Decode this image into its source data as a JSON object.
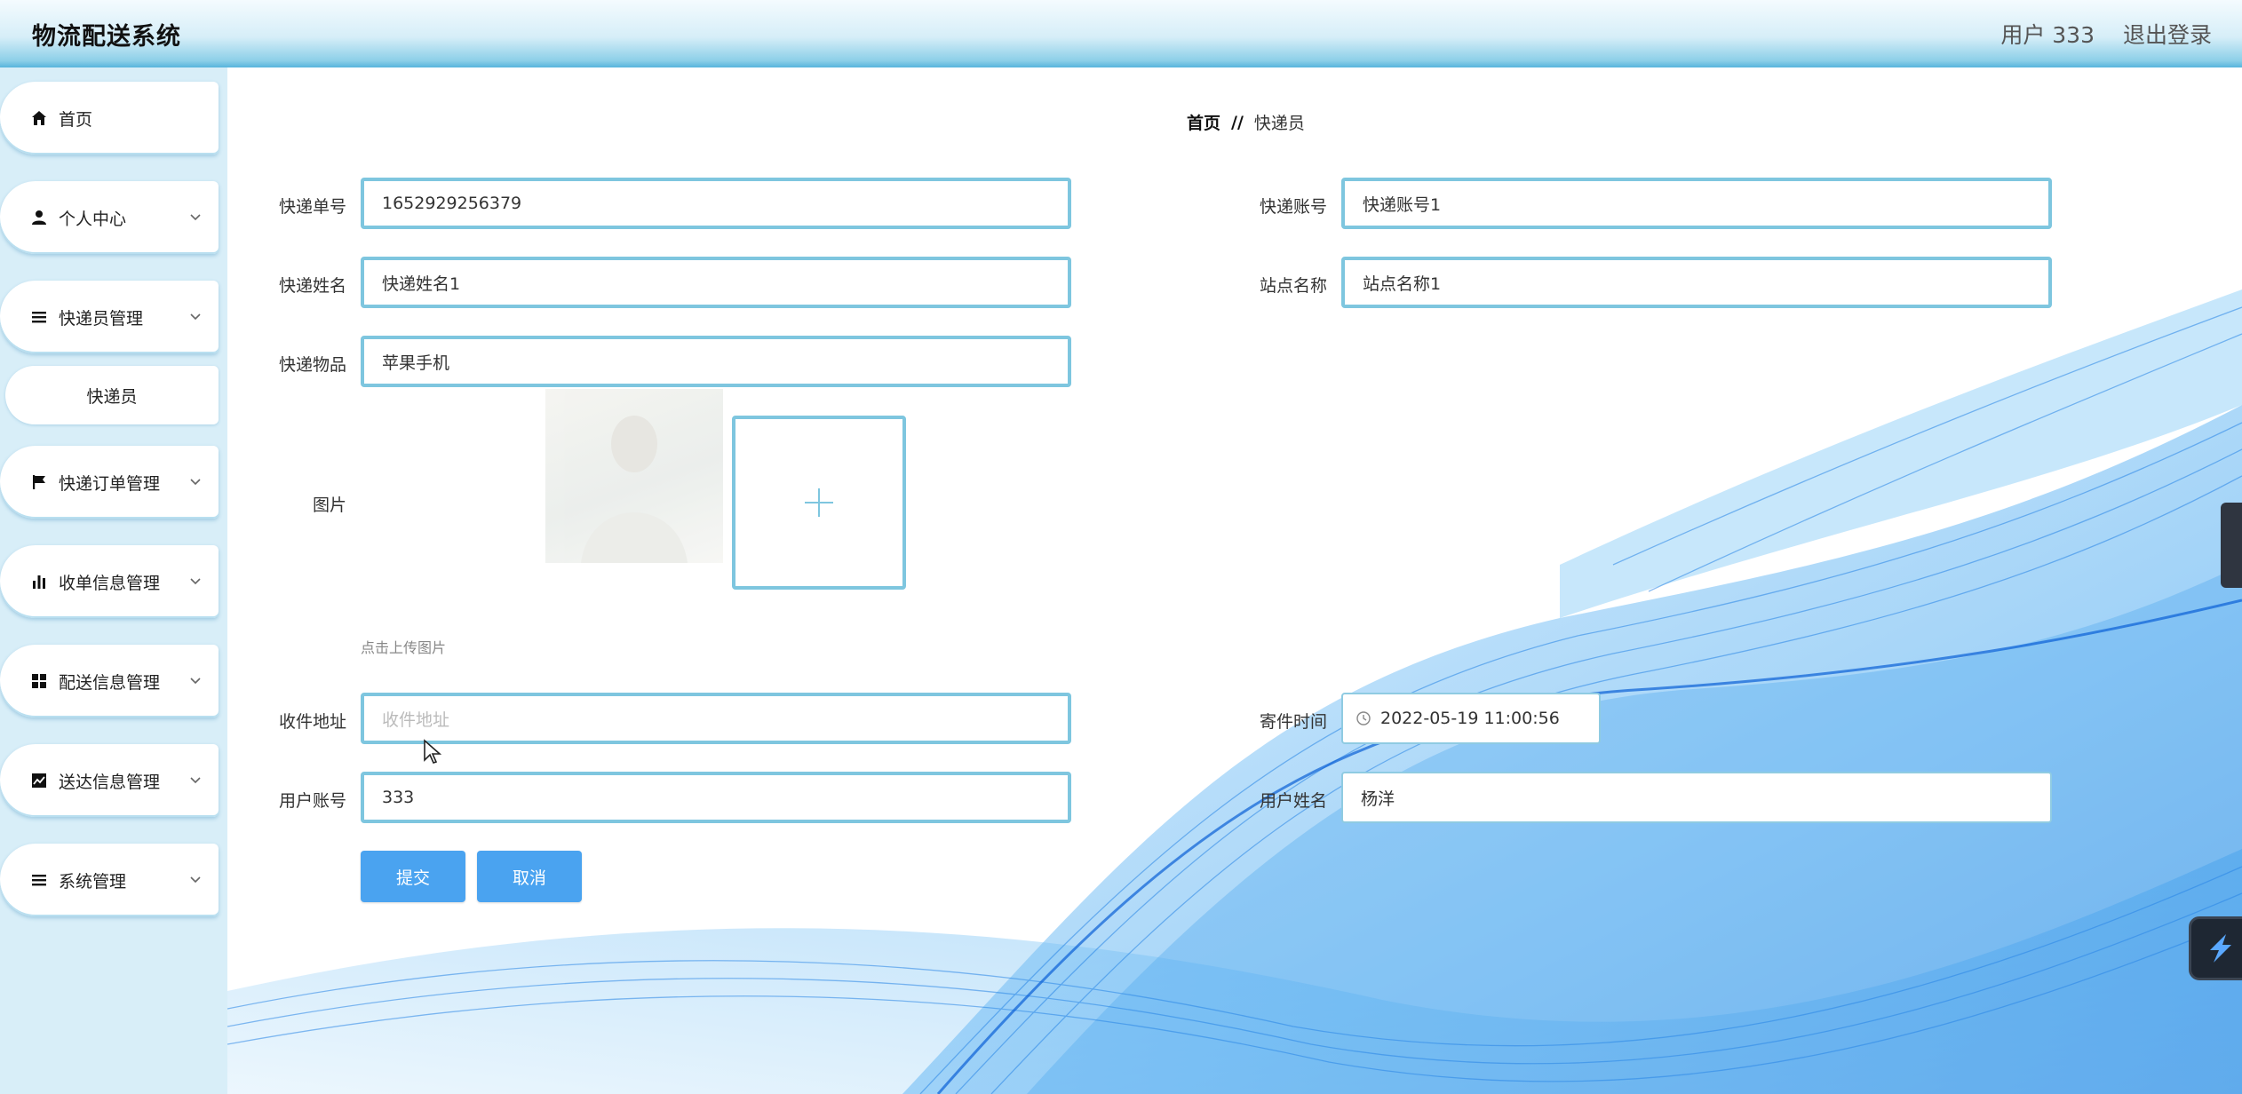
{
  "header": {
    "title": "物流配送系统",
    "user": "用户 333",
    "logout": "退出登录"
  },
  "sidebar": {
    "items": [
      {
        "label": "首页",
        "icon": "home-icon"
      },
      {
        "label": "个人中心",
        "icon": "user-icon"
      },
      {
        "label": "快递员管理",
        "icon": "list-icon"
      },
      {
        "label": "快递员",
        "icon": ""
      },
      {
        "label": "快递订单管理",
        "icon": "flag-icon"
      },
      {
        "label": "收单信息管理",
        "icon": "bar-chart-icon"
      },
      {
        "label": "配送信息管理",
        "icon": "grid-icon"
      },
      {
        "label": "送达信息管理",
        "icon": "line-chart-icon"
      },
      {
        "label": "系统管理",
        "icon": "list-icon"
      }
    ]
  },
  "breadcrumb": {
    "home": "首页",
    "sep": "//",
    "current": "快递员"
  },
  "form": {
    "tracking_no": {
      "label": "快递单号",
      "value": "1652929256379"
    },
    "courier_account": {
      "label": "快递账号",
      "value": "快递账号1"
    },
    "courier_name": {
      "label": "快递姓名",
      "value": "快递姓名1"
    },
    "station_name": {
      "label": "站点名称",
      "value": "站点名称1"
    },
    "item": {
      "label": "快递物品",
      "value": "苹果手机"
    },
    "image": {
      "label": "图片",
      "hint": "点击上传图片"
    },
    "address": {
      "label": "收件地址",
      "placeholder": "收件地址"
    },
    "send_time": {
      "label": "寄件时间",
      "value": "2022-05-19 11:00:56"
    },
    "user_account": {
      "label": "用户账号",
      "value": "333"
    },
    "user_name": {
      "label": "用户姓名",
      "value": "杨洋"
    },
    "submit": "提交",
    "cancel": "取消"
  },
  "colors": {
    "accent": "#4aa3f0",
    "border": "#7ec6df",
    "sidebar_bg": "#d8eef8"
  }
}
